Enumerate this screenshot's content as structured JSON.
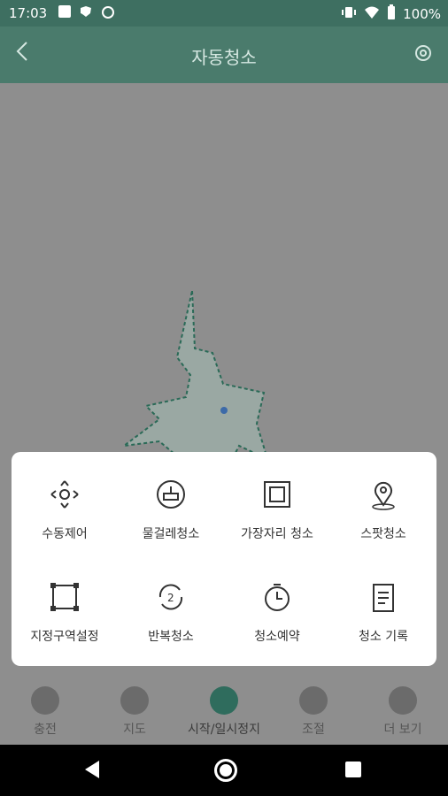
{
  "status_bar": {
    "time": "17:03",
    "battery": "100%",
    "icons": [
      "image-icon",
      "shield-icon",
      "sync-icon",
      "vibrate-icon",
      "wifi-icon",
      "battery-icon"
    ]
  },
  "appbar": {
    "title": "자동청소",
    "back_icon": "chevron-left-icon",
    "settings_icon": "gear-icon"
  },
  "menu": {
    "items": [
      {
        "label": "수동제어",
        "icon": "move-arrows-icon"
      },
      {
        "label": "물걸레청소",
        "icon": "mop-icon"
      },
      {
        "label": "가장자리 청소",
        "icon": "edge-clean-icon"
      },
      {
        "label": "스팟청소",
        "icon": "location-pin-icon"
      },
      {
        "label": "지정구역설정",
        "icon": "zone-square-icon"
      },
      {
        "label": "반복청소",
        "icon": "repeat-icon"
      },
      {
        "label": "청소예약",
        "icon": "timer-icon"
      },
      {
        "label": "청소 기록",
        "icon": "notepad-icon"
      }
    ]
  },
  "bottom_nav": {
    "items": [
      {
        "label": "충전",
        "icon": "charge-icon"
      },
      {
        "label": "지도",
        "icon": "map-icon"
      },
      {
        "label": "시작/일시정지",
        "icon": "play-icon",
        "active": true
      },
      {
        "label": "조절",
        "icon": "fan-icon"
      },
      {
        "label": "더 보기",
        "icon": "more-icon"
      }
    ]
  },
  "colors": {
    "accent": "#4a7b6c",
    "overlay": "#8e8e8e",
    "sheet": "#ffffff"
  }
}
